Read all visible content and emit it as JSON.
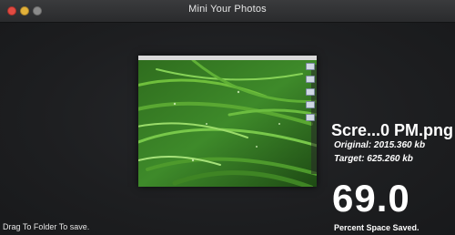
{
  "window": {
    "title": "Mini Your Photos"
  },
  "image": {
    "filename": "Scre...0 PM.png",
    "original": "Original: 2015.360 kb",
    "target": "Target: 625.260 kb"
  },
  "savings": {
    "value": "69.0",
    "caption": "Percent Space Saved."
  },
  "footer": {
    "hint": "Drag To Folder To save."
  },
  "colors": {
    "close": "#e14b42",
    "minimize": "#e3b13a",
    "zoom": "#8b8b8b",
    "background": "#1c1d1f",
    "text": "#ffffff"
  }
}
